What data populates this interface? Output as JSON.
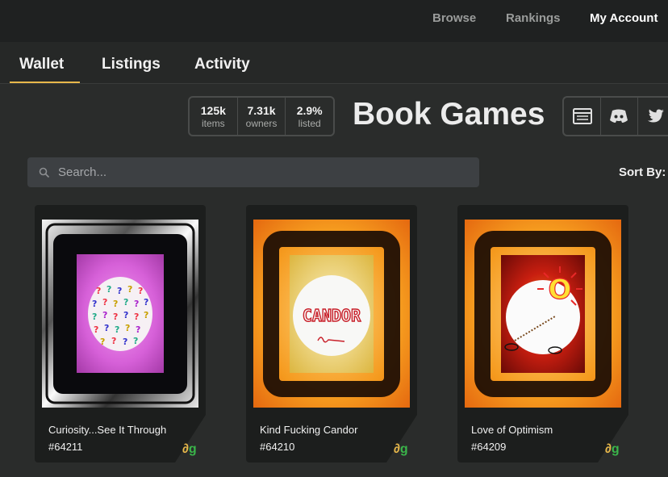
{
  "nav": {
    "browse": "Browse",
    "rankings": "Rankings",
    "account": "My Account"
  },
  "tabs": [
    "Wallet",
    "Listings",
    "Activity"
  ],
  "active_tab": "Wallet",
  "stats": [
    {
      "value": "125k",
      "label": "items"
    },
    {
      "value": "7.31k",
      "label": "owners"
    },
    {
      "value": "2.9%",
      "label": "listed"
    }
  ],
  "collection_title": "Book Games",
  "social_icons": [
    "website-icon",
    "discord-icon",
    "twitter-icon"
  ],
  "search": {
    "placeholder": "Search..."
  },
  "sort": {
    "label": "Sort By:"
  },
  "cards": [
    {
      "name": "Curiosity...See It Through",
      "id": "#64211"
    },
    {
      "name": "Kind Fucking Candor",
      "id": "#64210",
      "art_text": "CANDOR"
    },
    {
      "name": "Love of Optimism",
      "id": "#64209",
      "art_text": "O"
    }
  ],
  "colors": {
    "accent": "#e8b84a",
    "background": "#2a2c2b",
    "topbar": "#1f2121",
    "card": "#1c1e1d"
  }
}
